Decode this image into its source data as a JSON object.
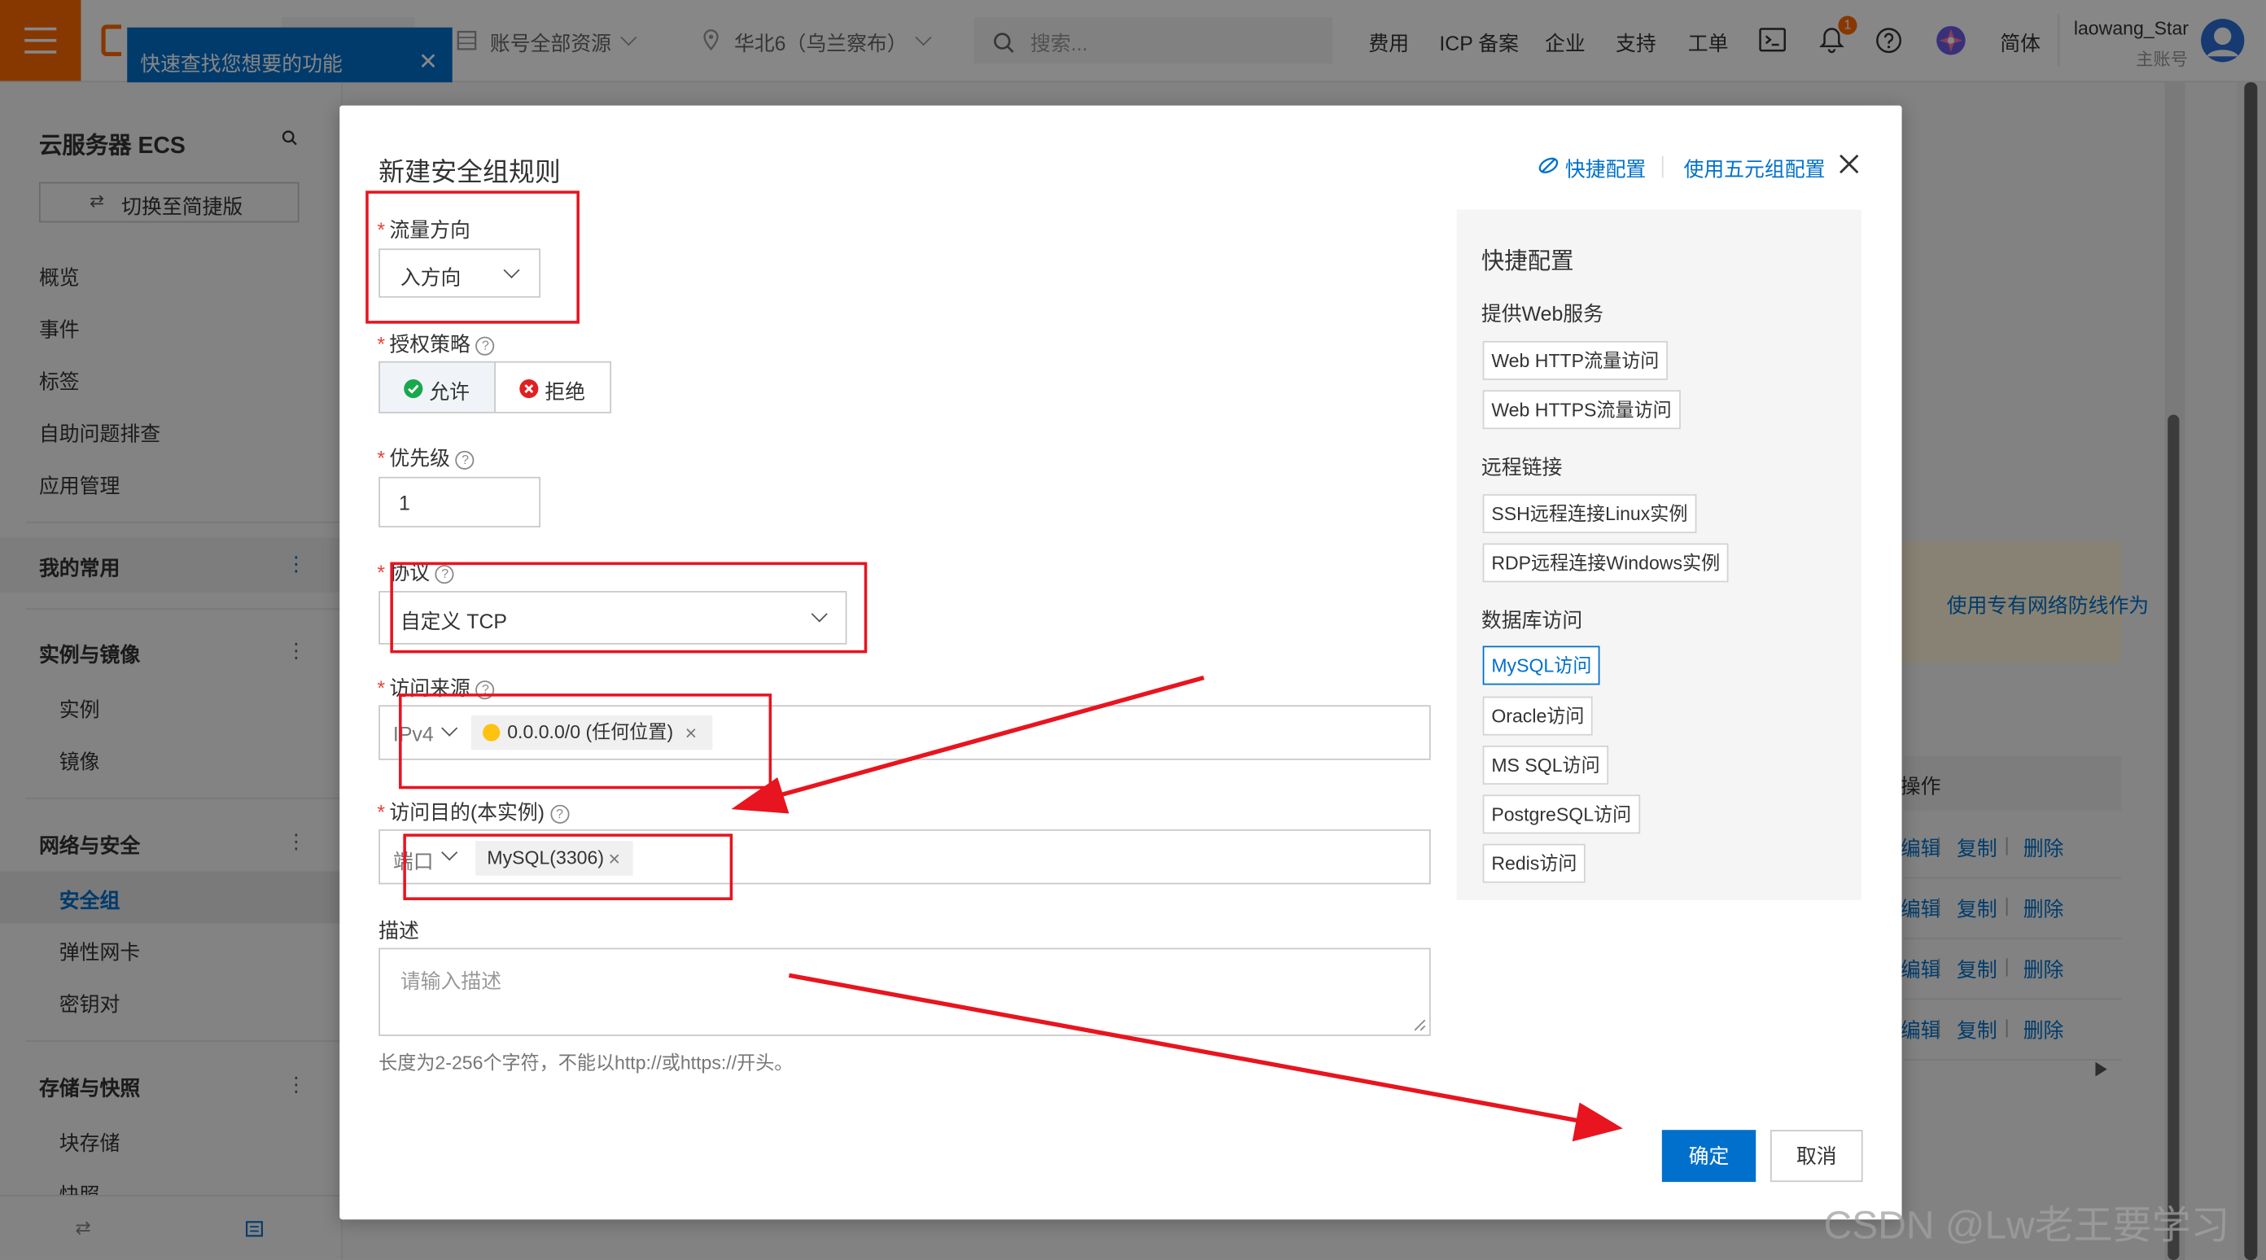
{
  "topbar": {
    "tooltip_text": "快速查找您想要的功能",
    "close_glyph": "✕",
    "resource_scope": "账号全部资源",
    "region": "华北6（乌兰察布）",
    "search_placeholder": "搜索...",
    "links": [
      "费用",
      "ICP 备案",
      "企业",
      "支持",
      "工单"
    ],
    "notification_count": "1",
    "language": "简体",
    "user_name": "laowang_Star",
    "user_role": "主账号",
    "brand_color": "#ff6a00"
  },
  "sidebar": {
    "title": "云服务器 ECS",
    "switch_button": "切换至简捷版",
    "top_items": [
      "概览",
      "事件",
      "标签",
      "自助问题排查",
      "应用管理"
    ],
    "groups": {
      "favorites": "我的常用",
      "instances_images": "实例与镜像",
      "instances": "实例",
      "images": "镜像",
      "network_security": "网络与安全",
      "security_group": "安全组",
      "eni": "弹性网卡",
      "keypair": "密钥对",
      "storage": "存储与快照",
      "block_storage": "块存储",
      "snapshot": "快照"
    },
    "dots": "⋮"
  },
  "modal": {
    "title": "新建安全组规则",
    "quick_config_link": "快捷配置",
    "five_tuple_link": "使用五元组配置",
    "direction": {
      "label": "流量方向",
      "value": "入方向"
    },
    "policy": {
      "label": "授权策略",
      "allow": "允许",
      "deny": "拒绝",
      "selected": "allow"
    },
    "priority": {
      "label": "优先级",
      "value": "1"
    },
    "protocol": {
      "label": "协议",
      "value": "自定义 TCP"
    },
    "source": {
      "label": "访问来源",
      "type": "IPv4",
      "tag": "0.0.0.0/0 (任何位置)"
    },
    "destination": {
      "label": "访问目的(本实例)",
      "type": "端口",
      "tag": "MySQL(3306)"
    },
    "description": {
      "label": "描述",
      "placeholder": "请输入描述",
      "hint": "长度为2-256个字符，不能以http://或https://开头。"
    },
    "required_mark": "*",
    "help_mark": "?",
    "remove_glyph": "×",
    "confirm": "确定",
    "cancel": "取消"
  },
  "quick_panel": {
    "title": "快捷配置",
    "sections": [
      {
        "header": "提供Web服务",
        "items": [
          "Web HTTP流量访问",
          "Web HTTPS流量访问"
        ]
      },
      {
        "header": "远程链接",
        "items": [
          "SSH远程连接Linux实例",
          "RDP远程连接Windows实例"
        ]
      },
      {
        "header": "数据库访问",
        "items": [
          "MySQL访问",
          "Oracle访问",
          "MS SQL访问",
          "PostgreSQL访问",
          "Redis访问"
        ]
      }
    ],
    "active_item": "MySQL访问"
  },
  "background": {
    "notice_text": "使用专有网络防线作为",
    "column_header": "操作",
    "row_actions": [
      "编辑",
      "复制",
      "删除"
    ],
    "separator": "|"
  },
  "watermark": "CSDN @Lw老王要学习",
  "colors": {
    "primary": "#0070cc",
    "annotation_red": "#e8141f",
    "allow_green": "#1aa84d",
    "deny_red": "#e02020"
  }
}
